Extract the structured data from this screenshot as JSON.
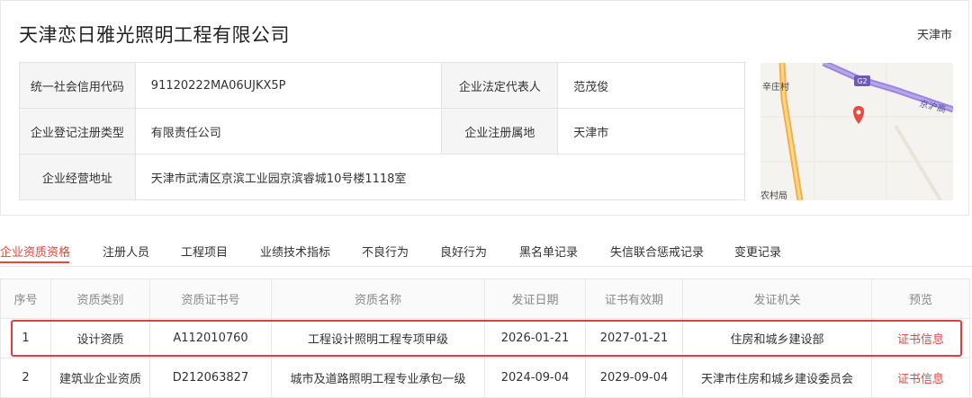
{
  "company": {
    "name": "天津恋日雅光照明工程有限公司",
    "region": "天津市"
  },
  "info": {
    "credit_code_label": "统一社会信用代码",
    "credit_code": "91120222MA06UJKX5P",
    "legal_rep_label": "企业法定代表人",
    "legal_rep": "范茂俊",
    "reg_type_label": "企业登记注册类型",
    "reg_type": "有限责任公司",
    "reg_place_label": "企业注册属地",
    "reg_place": "天津市",
    "address_label": "企业经营地址",
    "address": "天津市武清区京滨工业园京滨睿城10号楼1118室"
  },
  "map": {
    "labels": [
      "辛庄村",
      "G2",
      "京沪高",
      "农村局"
    ]
  },
  "tabs": [
    {
      "label": "企业资质资格",
      "active": true
    },
    {
      "label": "注册人员"
    },
    {
      "label": "工程项目"
    },
    {
      "label": "业绩技术指标"
    },
    {
      "label": "不良行为"
    },
    {
      "label": "良好行为"
    },
    {
      "label": "黑名单记录"
    },
    {
      "label": "失信联合惩戒记录"
    },
    {
      "label": "变更记录"
    }
  ],
  "table": {
    "headers": [
      "序号",
      "资质类别",
      "资质证书号",
      "资质名称",
      "发证日期",
      "证书有效期",
      "发证机关",
      "预览"
    ],
    "rows": [
      [
        "1",
        "设计资质",
        "A112010760",
        "工程设计照明工程专项甲级",
        "2026-01-21",
        "2027-01-21",
        "住房和城乡建设部",
        "证书信息"
      ],
      [
        "2",
        "建筑业企业资质",
        "D212063827",
        "城市及道路照明工程专业承包一级",
        "2024-09-04",
        "2029-09-04",
        "天津市住房和城乡建设委员会",
        "证书信息"
      ]
    ]
  },
  "colors": {
    "accent": "#e8453c",
    "highlight_border": "#e83a3f"
  }
}
